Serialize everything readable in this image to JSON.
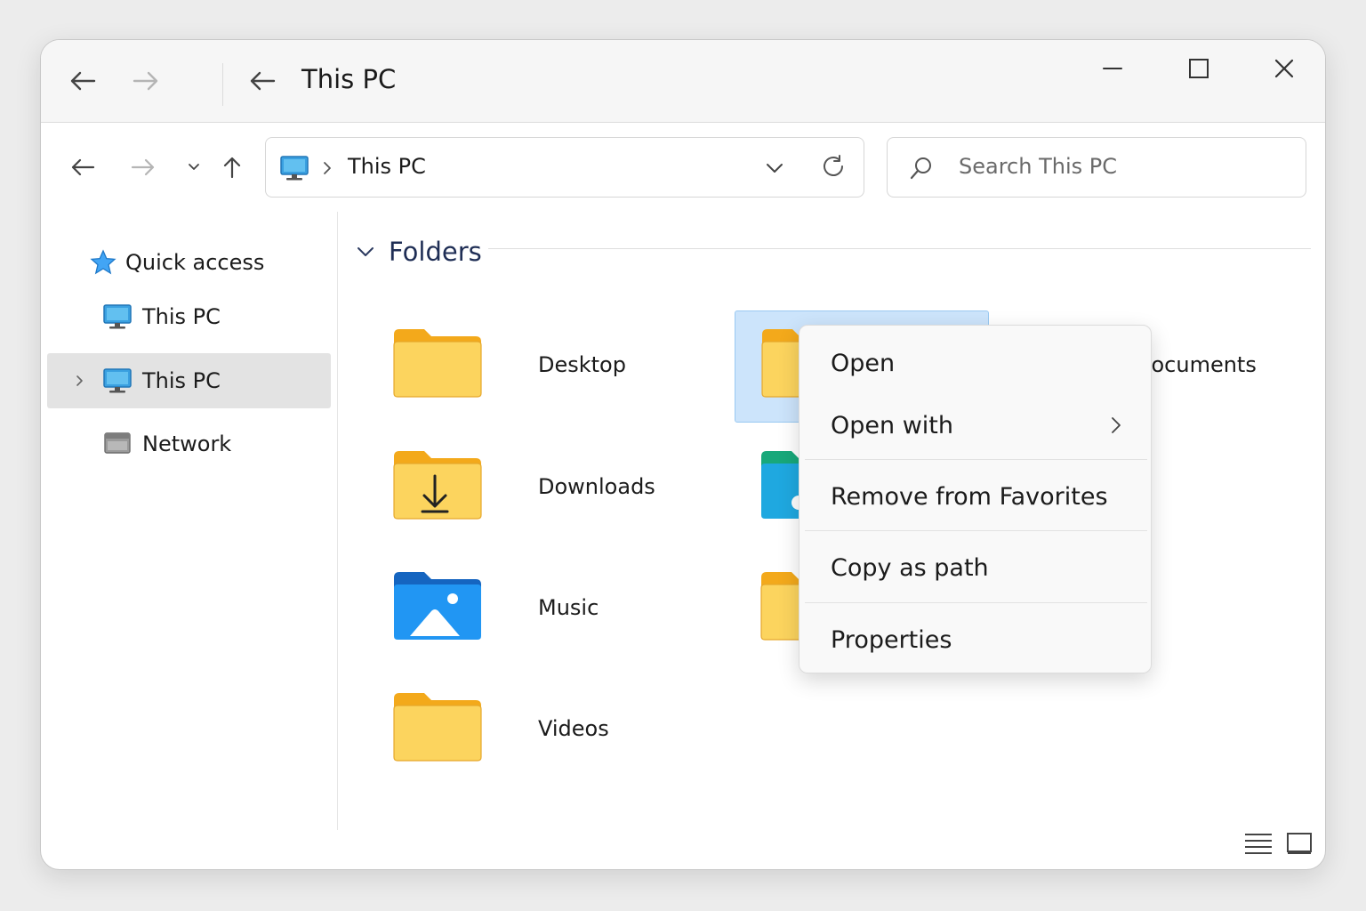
{
  "titlebar": {
    "title": "This PC",
    "minimize_icon": "minimize-icon",
    "maximize_icon": "maximize-icon",
    "close_icon": "close-icon"
  },
  "address": {
    "path_root_icon": "computer-icon",
    "path": "This PC",
    "search_placeholder": "Search This PC"
  },
  "sidebar": {
    "items": [
      {
        "label": "Quick access",
        "icon": "star-icon"
      },
      {
        "label": "This PC",
        "icon": "computer-icon"
      },
      {
        "label": "This PC",
        "icon": "computer-icon",
        "selected": true
      },
      {
        "label": "Network",
        "icon": "network-icon"
      }
    ]
  },
  "content": {
    "section_title": "Folders",
    "folders": [
      {
        "label": "Desktop",
        "icon": "folder-icon"
      },
      {
        "label": "",
        "icon": "folder-icon",
        "selected": true
      },
      {
        "label": "Documents",
        "icon": "folder-icon"
      },
      {
        "label": "Downloads",
        "icon": "downloads-folder-icon"
      },
      {
        "label": "",
        "icon": "music-folder-icon"
      },
      {
        "label": "Music",
        "icon": "pictures-folder-icon"
      },
      {
        "label": "",
        "icon": "folder-icon"
      },
      {
        "label": "Videos",
        "icon": "folder-icon"
      }
    ]
  },
  "context_menu": {
    "items": [
      {
        "label": "Open"
      },
      {
        "label": "Open with",
        "has_submenu": true
      },
      {
        "label": "Remove from Favorites"
      },
      {
        "label": "Copy as path"
      },
      {
        "label": "Properties"
      }
    ]
  },
  "colors": {
    "folder_yellow": "#fcd45e",
    "folder_tab": "#f3a91b",
    "selection_blue": "#cce4fb",
    "accent_blue": "#1e88d8"
  }
}
